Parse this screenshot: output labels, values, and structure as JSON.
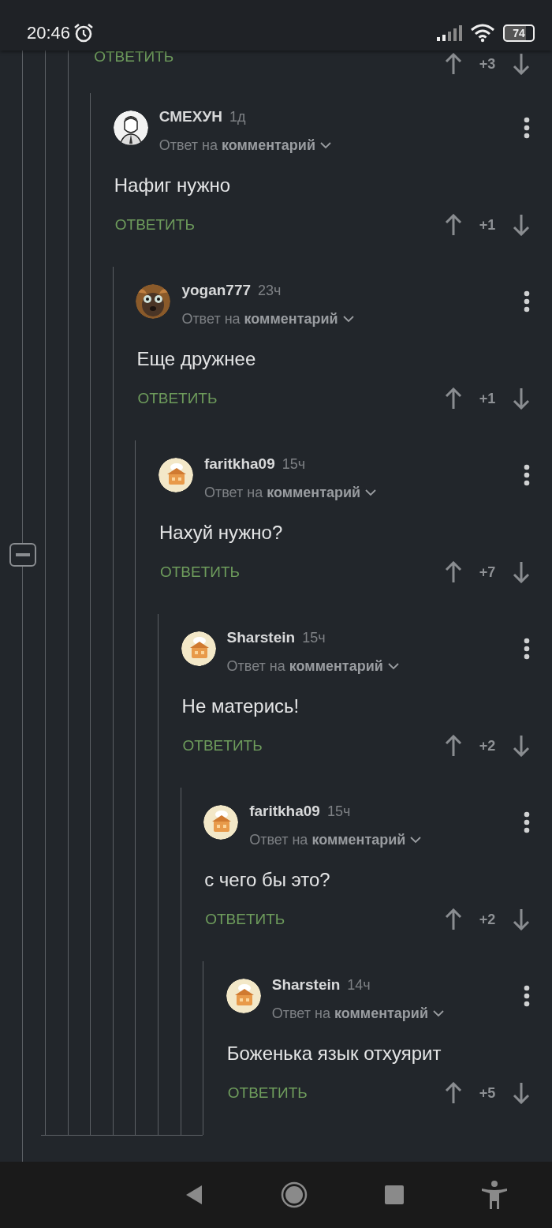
{
  "status_bar": {
    "time": "20:46",
    "battery": "74"
  },
  "thread": {
    "previous_reply": {
      "reply_label": "ОТВЕТИТЬ",
      "score": "+3"
    },
    "comments": [
      {
        "author": "СМЕХУН",
        "time": "1д",
        "reply_to": "Ответ на **комментарий**",
        "text": "Нафиг нужно",
        "reply_label": "ОТВЕТИТЬ",
        "score": "+1",
        "children": [
          {
            "author": "yogan777",
            "time": "23ч",
            "reply_to": "Ответ на **комментарий**",
            "text": "Еще дружнее",
            "reply_label": "ОТВЕТИТЬ",
            "score": "+1",
            "children": [
              {
                "author": "faritkha09",
                "time": "15ч",
                "reply_to": "Ответ на **комментарий**",
                "text": "Нахуй нужно?",
                "reply_label": "ОТВЕТИТЬ",
                "score": "+7",
                "children": [
                  {
                    "author": "Sharstein",
                    "time": "15ч",
                    "reply_to": "Ответ на **комментарий**",
                    "text": "Не матерись!",
                    "reply_label": "ОТВЕТИТЬ",
                    "score": "+2",
                    "children": [
                      {
                        "author": "faritkha09",
                        "time": "15ч",
                        "reply_to": "Ответ на **комментарий**",
                        "text": "с чего бы это?",
                        "reply_label": "ОТВЕТИТЬ",
                        "score": "+2",
                        "children": [
                          {
                            "author": "Sharstein",
                            "time": "14ч",
                            "reply_to": "Ответ на **комментарий**",
                            "text": "Боженька язык отхуярит",
                            "reply_label": "ОТВЕТИТЬ",
                            "score": "+5"
                          }
                        ]
                      }
                    ]
                  }
                ]
              }
            ]
          }
        ]
      }
    ]
  }
}
